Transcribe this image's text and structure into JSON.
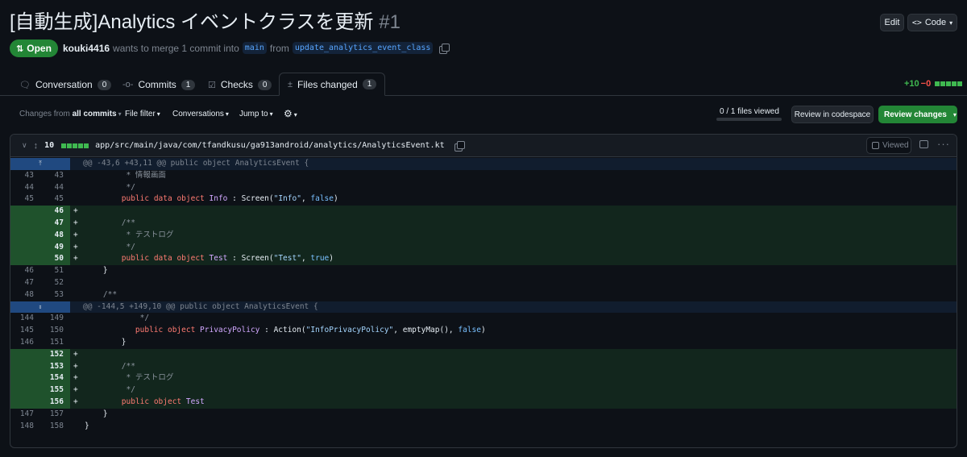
{
  "pr": {
    "title": "[自動生成]Analytics イベントクラスを更新",
    "number": "#1",
    "state": "Open",
    "author": "kouki4416",
    "merge_text": "wants to merge 1 commit into",
    "base_branch": "main",
    "from_text": "from",
    "head_branch": "update_analytics_event_class"
  },
  "header_buttons": {
    "edit": "Edit",
    "code": "Code"
  },
  "tabs": [
    {
      "label": "Conversation",
      "count": "0"
    },
    {
      "label": "Commits",
      "count": "1"
    },
    {
      "label": "Checks",
      "count": "0"
    },
    {
      "label": "Files changed",
      "count": "1"
    }
  ],
  "diffstat": {
    "additions": "+10",
    "deletions": "−0"
  },
  "toolbar": {
    "changes_from_prefix": "Changes from",
    "changes_from_value": "all commits",
    "file_filter": "File filter",
    "conversations": "Conversations",
    "jump_to": "Jump to",
    "files_viewed": "0 / 1 files viewed",
    "files_viewed_fraction": 0,
    "review_codespace": "Review in codespace",
    "review_changes": "Review changes"
  },
  "file": {
    "change_count": "10",
    "path": "app/src/main/java/com/tfandkusu/ga913android/analytics/AnalyticsEvent.kt",
    "viewed_label": "Viewed"
  },
  "diff_lines": [
    {
      "type": "hunk",
      "text": "@@ -43,6 +43,11 @@ public object AnalyticsEvent {"
    },
    {
      "type": "ctx",
      "old": "43",
      "new": "43",
      "text": "         * 情報画面"
    },
    {
      "type": "ctx",
      "old": "44",
      "new": "44",
      "text": "         */"
    },
    {
      "type": "ctx",
      "old": "45",
      "new": "45",
      "text": "        public data object Info : Screen(\"Info\", false)"
    },
    {
      "type": "add",
      "old": "",
      "new": "46",
      "text": ""
    },
    {
      "type": "add",
      "old": "",
      "new": "47",
      "text": "        /**"
    },
    {
      "type": "add",
      "old": "",
      "new": "48",
      "text": "         * テストログ"
    },
    {
      "type": "add",
      "old": "",
      "new": "49",
      "text": "         */"
    },
    {
      "type": "add",
      "old": "",
      "new": "50",
      "text": "        public data object Test : Screen(\"Test\", true)"
    },
    {
      "type": "ctx",
      "old": "46",
      "new": "51",
      "text": "    }"
    },
    {
      "type": "ctx",
      "old": "47",
      "new": "52",
      "text": ""
    },
    {
      "type": "ctx",
      "old": "48",
      "new": "53",
      "text": "    /**"
    },
    {
      "type": "hunk2",
      "text": "@@ -144,5 +149,10 @@ public object AnalyticsEvent {"
    },
    {
      "type": "ctx",
      "old": "144",
      "new": "149",
      "text": "            */"
    },
    {
      "type": "ctx",
      "old": "145",
      "new": "150",
      "text": "           public object PrivacyPolicy : Action(\"InfoPrivacyPolicy\", emptyMap(), false)"
    },
    {
      "type": "ctx",
      "old": "146",
      "new": "151",
      "text": "        }"
    },
    {
      "type": "add",
      "old": "",
      "new": "152",
      "text": ""
    },
    {
      "type": "add",
      "old": "",
      "new": "153",
      "text": "        /**"
    },
    {
      "type": "add",
      "old": "",
      "new": "154",
      "text": "         * テストログ"
    },
    {
      "type": "add",
      "old": "",
      "new": "155",
      "text": "         */"
    },
    {
      "type": "add",
      "old": "",
      "new": "156",
      "text": "        public object Test"
    },
    {
      "type": "ctx",
      "old": "147",
      "new": "157",
      "text": "    }"
    },
    {
      "type": "ctx",
      "old": "148",
      "new": "158",
      "text": "}"
    }
  ]
}
